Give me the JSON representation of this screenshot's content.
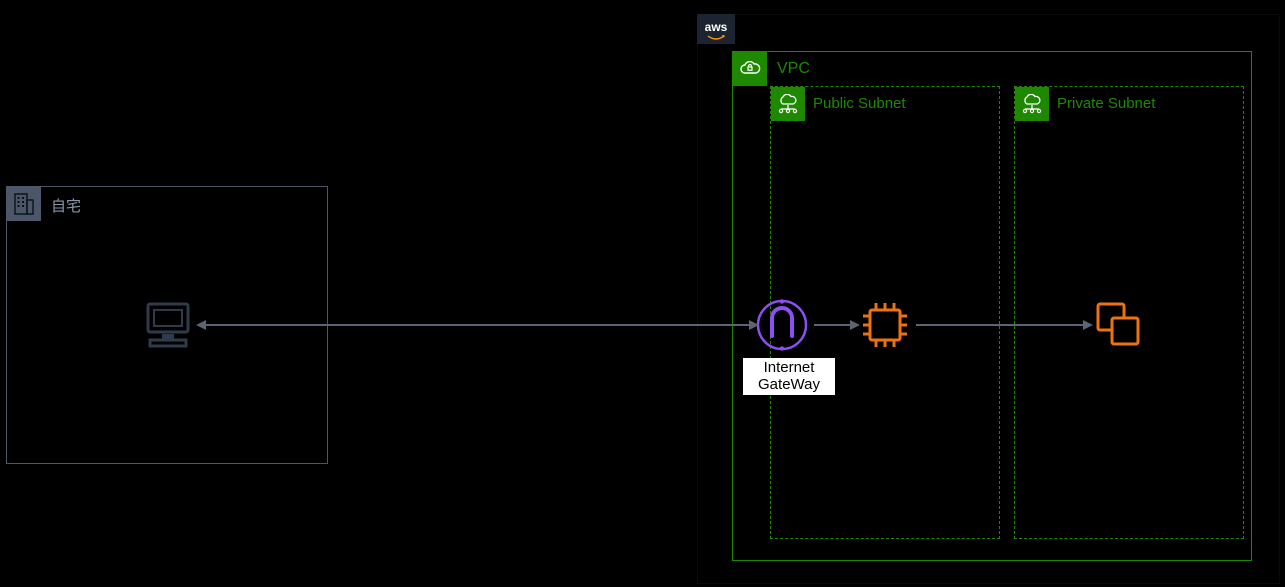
{
  "home": {
    "label": "自宅"
  },
  "aws": {
    "logo_text": "aws"
  },
  "vpc": {
    "label": "VPC"
  },
  "subnets": {
    "public": {
      "label": "Public Subnet"
    },
    "private": {
      "label": "Private Subnet"
    }
  },
  "igw": {
    "label_line1": "Internet",
    "label_line2": "GateWay"
  },
  "colors": {
    "vpc_green": "#1e8900",
    "home_border": "#4b5768",
    "connector": "#5a6472",
    "igw_purple": "#8c4ff0",
    "ec2_orange": "#ed7211"
  }
}
